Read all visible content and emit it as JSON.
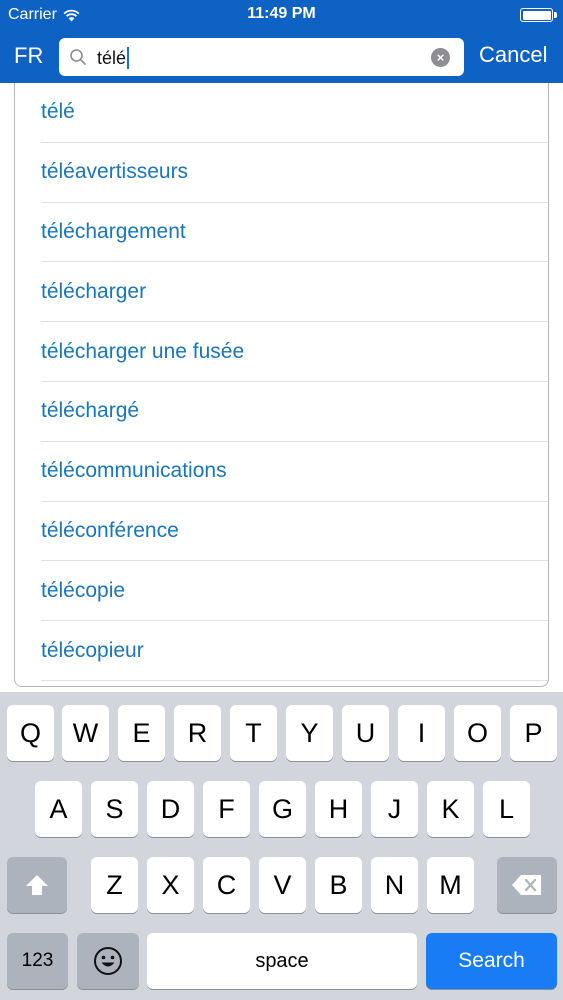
{
  "status_bar": {
    "carrier": "Carrier",
    "time": "11:49 PM",
    "wifi_icon": "wifi-icon",
    "battery_icon": "battery-icon"
  },
  "search_bar": {
    "language": "FR",
    "query": "télé",
    "cancel_label": "Cancel",
    "search_icon": "search-icon",
    "clear_icon": "clear-icon"
  },
  "suggestions": [
    "télé",
    "téléavertisseurs",
    "téléchargement",
    "télécharger",
    "télécharger une fusée",
    "téléchargé",
    "télécommunications",
    "téléconférence",
    "télécopie",
    "télécopieur"
  ],
  "keyboard": {
    "row1": [
      "Q",
      "W",
      "E",
      "R",
      "T",
      "Y",
      "U",
      "I",
      "O",
      "P"
    ],
    "row2": [
      "A",
      "S",
      "D",
      "F",
      "G",
      "H",
      "J",
      "K",
      "L"
    ],
    "row3": [
      "Z",
      "X",
      "C",
      "V",
      "B",
      "N",
      "M"
    ],
    "numbers_label": "123",
    "space_label": "space",
    "search_label": "Search",
    "shift_icon": "shift-icon",
    "delete_icon": "delete-icon",
    "emoji_icon": "emoji-icon"
  },
  "colors": {
    "header_bg": "#0d62c4",
    "suggestion_text": "#1b75bb",
    "search_key": "#1a7cf5",
    "keyboard_bg": "#d2d5db"
  }
}
